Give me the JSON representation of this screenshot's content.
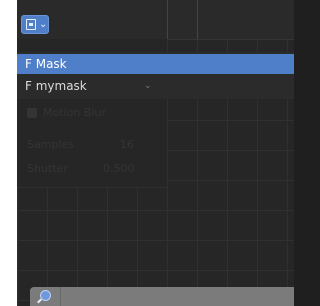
{
  "header": {
    "editor_type_icon": "image-editor-icon",
    "dropdown_icon": "chevron-down-icon"
  },
  "mask_menu": {
    "items": [
      {
        "label": "F Mask",
        "selected": true
      },
      {
        "label": "F mymask",
        "selected": false
      }
    ]
  },
  "panel": {
    "motion_blur_label": "Motion Blur",
    "samples_label": "Samples",
    "samples_value": "16",
    "shutter_label": "Shutter",
    "shutter_value": "0.500"
  },
  "footer": {
    "search_icon": "search-icon"
  },
  "colors": {
    "accent": "#4f7fc9",
    "background": "#262626",
    "footer": "#7b7b7b"
  }
}
